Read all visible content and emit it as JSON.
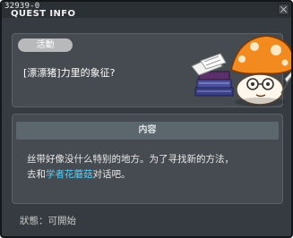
{
  "window": {
    "quest_id": "32939-0",
    "title": "QUEST INFO",
    "close_icon": "close-icon"
  },
  "quest": {
    "category_tag": "活動",
    "name": "[漂漂猪]力里的象征?",
    "illustration": "mushroom-scholar-illustration"
  },
  "content": {
    "header": "内容",
    "desc_part1": "丝带好像没什么特别的地方。为了寻找新的方法，",
    "desc_part2a": "去和",
    "npc_name": "学者花蘑菇",
    "desc_part2b": "对话吧。"
  },
  "status": {
    "label": "狀態",
    "separator": "：",
    "value": "可開始"
  },
  "colors": {
    "background": "#353b40",
    "npc_highlight": "#4fd1ff",
    "header_bar": "#5c666d"
  }
}
